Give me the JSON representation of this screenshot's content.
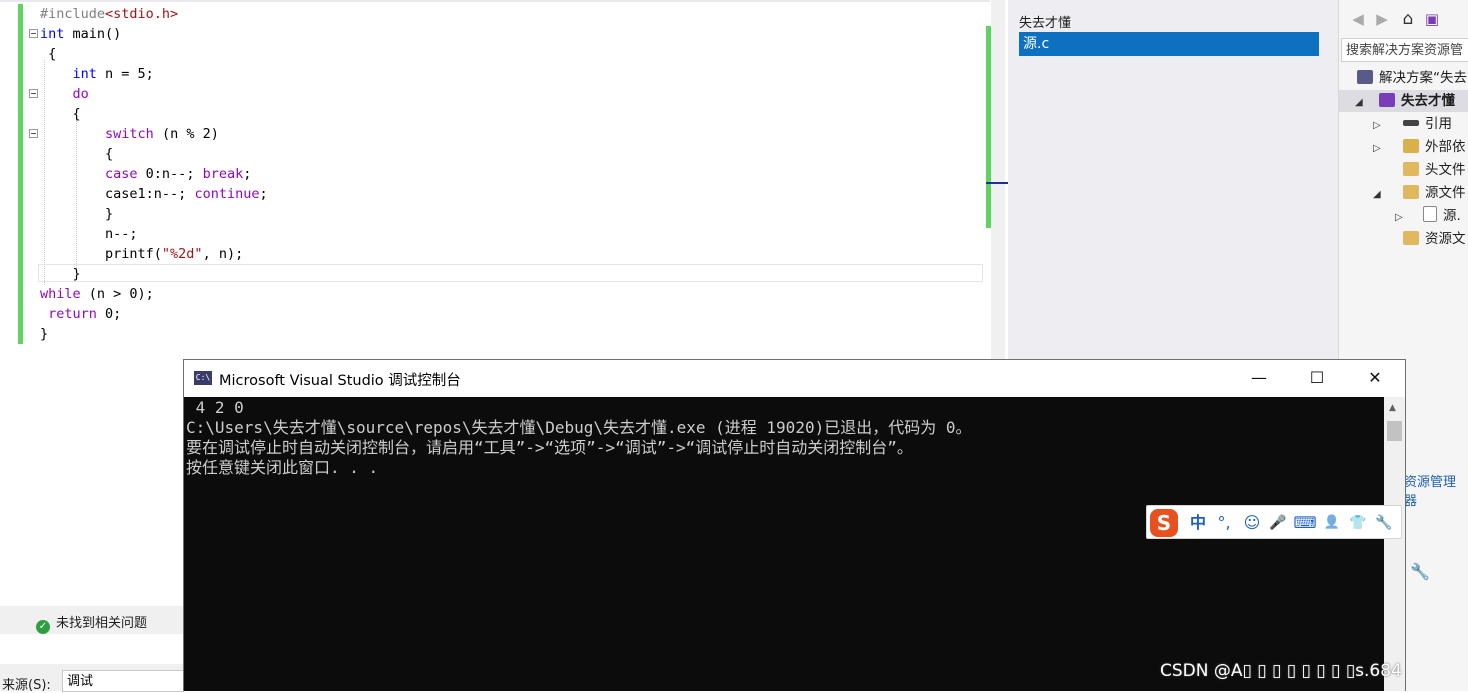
{
  "editor": {
    "lines": [
      {
        "segments": [
          {
            "t": "#include",
            "c": "pre"
          },
          {
            "t": "<stdio.h>",
            "c": "inc"
          }
        ]
      },
      {
        "segments": [
          {
            "t": "int",
            "c": "kw"
          },
          {
            "t": " main()",
            "c": ""
          }
        ]
      },
      {
        "segments": [
          {
            "t": " {",
            "c": ""
          }
        ]
      },
      {
        "segments": [
          {
            "t": "    ",
            "c": ""
          },
          {
            "t": "int",
            "c": "kw"
          },
          {
            "t": " n = 5;",
            "c": ""
          }
        ]
      },
      {
        "segments": [
          {
            "t": "    ",
            "c": ""
          },
          {
            "t": "do",
            "c": "kw2"
          }
        ]
      },
      {
        "segments": [
          {
            "t": "    {",
            "c": ""
          }
        ]
      },
      {
        "segments": [
          {
            "t": "        ",
            "c": ""
          },
          {
            "t": "switch",
            "c": "kw2"
          },
          {
            "t": " (n % 2)",
            "c": ""
          }
        ]
      },
      {
        "segments": [
          {
            "t": "        {",
            "c": ""
          }
        ]
      },
      {
        "segments": [
          {
            "t": "        ",
            "c": ""
          },
          {
            "t": "case",
            "c": "kw2"
          },
          {
            "t": " 0:n--; ",
            "c": ""
          },
          {
            "t": "break",
            "c": "kw2"
          },
          {
            "t": ";",
            "c": ""
          }
        ]
      },
      {
        "segments": [
          {
            "t": "        case1:n--; ",
            "c": ""
          },
          {
            "t": "continue",
            "c": "kw2"
          },
          {
            "t": ";",
            "c": ""
          }
        ]
      },
      {
        "segments": [
          {
            "t": "        }",
            "c": ""
          }
        ]
      },
      {
        "segments": [
          {
            "t": "        n--;",
            "c": ""
          }
        ]
      },
      {
        "segments": [
          {
            "t": "        printf(",
            "c": ""
          },
          {
            "t": "\"%2d\"",
            "c": "str"
          },
          {
            "t": ", n);",
            "c": ""
          }
        ]
      },
      {
        "segments": [
          {
            "t": "    }",
            "c": ""
          }
        ]
      },
      {
        "segments": [
          {
            "t": "while",
            "c": "kw2"
          },
          {
            "t": " (n > 0);",
            "c": ""
          }
        ]
      },
      {
        "segments": [
          {
            "t": " ",
            "c": ""
          },
          {
            "t": "return",
            "c": "kw2"
          },
          {
            "t": " 0;",
            "c": ""
          }
        ]
      },
      {
        "segments": [
          {
            "t": "}",
            "c": ""
          }
        ]
      }
    ]
  },
  "middle_panel": {
    "project_label": "失去才懂",
    "selected_file": "源.c"
  },
  "solution_explorer": {
    "search_placeholder": "搜索解决方案资源管",
    "tree": [
      {
        "label": "解决方案“失去",
        "icon": "solution-icon"
      },
      {
        "label": "失去才懂",
        "icon": "project-icon"
      },
      {
        "label": "引用",
        "icon": "references-icon"
      },
      {
        "label": "外部依",
        "icon": "external-deps-icon"
      },
      {
        "label": "头文件",
        "icon": "folder-icon"
      },
      {
        "label": "源文件",
        "icon": "folder-icon"
      },
      {
        "label": "源.",
        "icon": "c-file-icon"
      },
      {
        "label": "资源文",
        "icon": "folder-icon"
      }
    ],
    "bottom_link": "资源管理器"
  },
  "error_list": {
    "status": "未找到相关问题"
  },
  "output": {
    "source_label": "来源(S):",
    "source_value": "调试"
  },
  "console": {
    "title": "Microsoft Visual Studio 调试控制台",
    "icon_text": "C:\\",
    "lines": [
      " 4 2 0",
      "C:\\Users\\失去才懂\\source\\repos\\失去才懂\\Debug\\失去才懂.exe (进程 19020)已退出，代码为 0。",
      "要在调试停止时自动关闭控制台，请启用“工具”->“选项”->“调试”->“调试停止时自动关闭控制台”。",
      "按任意键关闭此窗口. . ."
    ],
    "minimize_glyph": "—",
    "maximize_glyph": "☐",
    "close_glyph": "✕"
  },
  "ime": {
    "logo": "S",
    "lang": "中",
    "punct": "°,",
    "emoji": "☺",
    "voice": "🎤",
    "keyboard": "⌨",
    "user": "👤",
    "skin": "👕",
    "tools": "🔧"
  },
  "watermark": "CSDN @A▯ ▯ ▯ ▯ ▯ ▯ ▯ ▯s.684"
}
